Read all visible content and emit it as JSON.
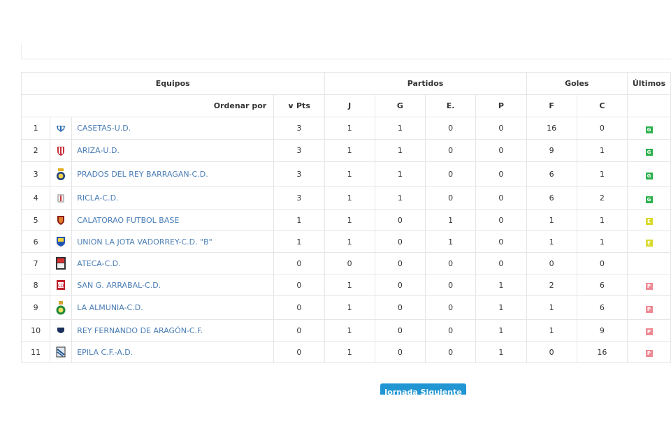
{
  "header": {
    "equipos": "Equipos",
    "partidos": "Partidos",
    "goles": "Goles",
    "ultimos": "Últimos",
    "ordenar_por": "Ordenar por",
    "pts": "Pts",
    "j": "J",
    "g": "G",
    "e": "E.",
    "p": "P",
    "f": "F",
    "c": "C"
  },
  "rows": [
    {
      "pos": "1",
      "team": "CASETAS-U.D.",
      "crest": "casetas-crest-icon",
      "pts": "3",
      "j": "1",
      "g": "1",
      "e": "0",
      "p": "0",
      "f": "16",
      "c": "0",
      "last": "G"
    },
    {
      "pos": "2",
      "team": "ARIZA-U.D.",
      "crest": "ariza-crest-icon",
      "pts": "3",
      "j": "1",
      "g": "1",
      "e": "0",
      "p": "0",
      "f": "9",
      "c": "1",
      "last": "G"
    },
    {
      "pos": "3",
      "team": "PRADOS DEL REY BARRAGAN-C.D.",
      "crest": "prados-crest-icon",
      "pts": "3",
      "j": "1",
      "g": "1",
      "e": "0",
      "p": "0",
      "f": "6",
      "c": "1",
      "last": "G"
    },
    {
      "pos": "4",
      "team": "RICLA-C.D.",
      "crest": "ricla-crest-icon",
      "pts": "3",
      "j": "1",
      "g": "1",
      "e": "0",
      "p": "0",
      "f": "6",
      "c": "2",
      "last": "G"
    },
    {
      "pos": "5",
      "team": "CALATORAO FUTBOL BASE",
      "crest": "calatorao-crest-icon",
      "pts": "1",
      "j": "1",
      "g": "0",
      "e": "1",
      "p": "0",
      "f": "1",
      "c": "1",
      "last": "E"
    },
    {
      "pos": "6",
      "team": "UNION LA JOTA VADORREY-C.D. \"B\"",
      "crest": "union-jota-crest-icon",
      "pts": "1",
      "j": "1",
      "g": "0",
      "e": "1",
      "p": "0",
      "f": "1",
      "c": "1",
      "last": "E"
    },
    {
      "pos": "7",
      "team": "ATECA-C.D.",
      "crest": "ateca-crest-icon",
      "pts": "0",
      "j": "0",
      "g": "0",
      "e": "0",
      "p": "0",
      "f": "0",
      "c": "0",
      "last": ""
    },
    {
      "pos": "8",
      "team": "SAN G. ARRABAL-C.D.",
      "crest": "san-g-arrabal-crest-icon",
      "pts": "0",
      "j": "1",
      "g": "0",
      "e": "0",
      "p": "1",
      "f": "2",
      "c": "6",
      "last": "P"
    },
    {
      "pos": "9",
      "team": "LA ALMUNIA-C.D.",
      "crest": "la-almunia-crest-icon",
      "pts": "0",
      "j": "1",
      "g": "0",
      "e": "0",
      "p": "1",
      "f": "1",
      "c": "6",
      "last": "P"
    },
    {
      "pos": "10",
      "team": "REY FERNANDO DE ARAGÓN-C.F.",
      "crest": "rey-fernando-crest-icon",
      "pts": "0",
      "j": "1",
      "g": "0",
      "e": "0",
      "p": "1",
      "f": "1",
      "c": "9",
      "last": "P"
    },
    {
      "pos": "11",
      "team": "EPILA C.F.-A.D.",
      "crest": "epila-crest-icon",
      "pts": "0",
      "j": "1",
      "g": "0",
      "e": "0",
      "p": "1",
      "f": "0",
      "c": "16",
      "last": "P"
    }
  ],
  "next_button": {
    "label": "Jornada Siguiente ❯"
  },
  "colors": {
    "link": "#4a7db5",
    "win": "#2eb14f",
    "draw": "#d9d92a",
    "loss": "#ee8a93",
    "button": "#2196d3"
  }
}
